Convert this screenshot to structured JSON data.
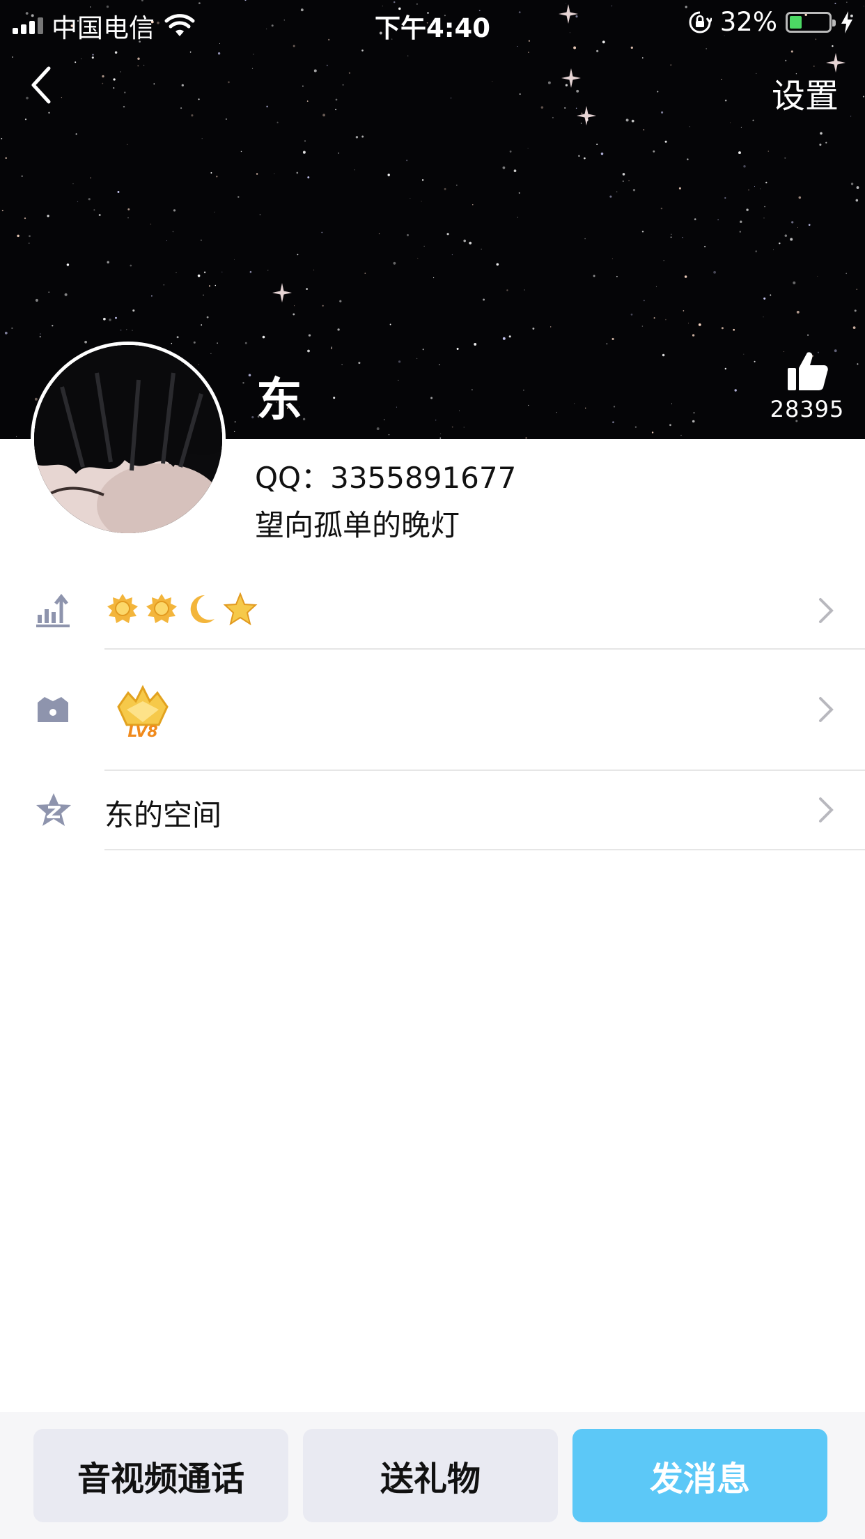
{
  "status_bar": {
    "carrier": "中国电信",
    "time": "下午4:40",
    "battery_percent": "32%",
    "battery_level": 0.32,
    "icons": [
      "signal-icon",
      "wifi-icon",
      "orientation-lock-icon",
      "battery-icon",
      "charging-bolt-icon"
    ]
  },
  "nav": {
    "back_icon": "chevron-left-icon",
    "settings_label": "设置"
  },
  "profile": {
    "nickname": "东",
    "like_count": "28395",
    "qq_line": "QQ：3355891677",
    "signature": "望向孤单的晚灯"
  },
  "rows": {
    "level": {
      "icon": "level-bars-icon",
      "badges": [
        "sun-icon",
        "sun-icon",
        "moon-icon",
        "star-icon"
      ]
    },
    "vip": {
      "icon": "crown-icon",
      "badge_text": "LV8"
    },
    "space": {
      "icon": "qzone-star-icon",
      "label": "东的空间"
    }
  },
  "actions": {
    "call_label": "音视频通话",
    "gift_label": "送礼物",
    "message_label": "发消息"
  },
  "colors": {
    "accent_blue": "#5cc8f7",
    "button_gray": "#e9eaf2",
    "icon_gray": "#8e94ad",
    "badge_gold": "#f6c94a"
  }
}
